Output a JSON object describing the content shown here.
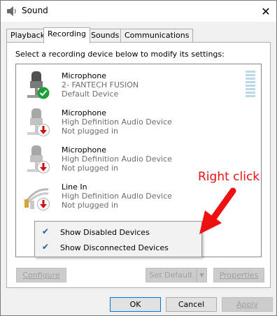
{
  "window": {
    "title": "Sound",
    "close_glyph": "✕"
  },
  "tabs": [
    {
      "label": "Playback",
      "active": false
    },
    {
      "label": "Recording",
      "active": true
    },
    {
      "label": "Sounds",
      "active": false
    },
    {
      "label": "Communications",
      "active": false
    }
  ],
  "panel": {
    "instruction": "Select a recording device below to modify its settings:"
  },
  "devices": [
    {
      "name": "Microphone",
      "description": "2- FANTECH FUSION",
      "status": "Default Device",
      "icon": "microphone-icon",
      "badge": "default-check-badge-icon"
    },
    {
      "name": "Microphone",
      "description": "High Definition Audio Device",
      "status": "Not plugged in",
      "icon": "microphone-icon",
      "badge": "unplugged-arrow-badge-icon"
    },
    {
      "name": "Microphone",
      "description": "High Definition Audio Device",
      "status": "Not plugged in",
      "icon": "microphone-icon",
      "badge": "unplugged-arrow-badge-icon"
    },
    {
      "name": "Line In",
      "description": "High Definition Audio Device",
      "status": "Not plugged in",
      "icon": "line-in-cable-icon",
      "badge": "unplugged-arrow-badge-icon"
    }
  ],
  "context_menu": {
    "items": [
      {
        "label": "Show Disabled Devices",
        "checked": true
      },
      {
        "label": "Show Disconnected Devices",
        "checked": true
      }
    ]
  },
  "annotation": {
    "text": "Right click",
    "color": "#ee1111"
  },
  "buttons": {
    "configure": "Configure",
    "set_default": "Set Default",
    "properties": "Properties",
    "ok": "OK",
    "cancel": "Cancel",
    "apply": "Apply"
  },
  "colors": {
    "default_badge": "#1e9e3a",
    "unplugged_badge": "#d01010",
    "accent": "#0078d7"
  }
}
